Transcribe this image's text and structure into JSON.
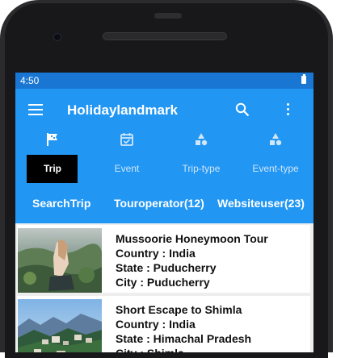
{
  "status_bar": {
    "time": "4:50"
  },
  "app_bar": {
    "title": "Holidaylandmark"
  },
  "tabs": [
    {
      "label": "Trip",
      "icon": "flag-icon",
      "active": true
    },
    {
      "label": "Event",
      "icon": "calendar-check-icon",
      "active": false
    },
    {
      "label": "Trip-type",
      "icon": "shapes-icon",
      "active": false
    },
    {
      "label": "Event-type",
      "icon": "shapes-icon",
      "active": false
    }
  ],
  "subtabs": [
    {
      "label": "SearchTrip"
    },
    {
      "label": "Touroperator(12)"
    },
    {
      "label": "Websiteuser(23)"
    }
  ],
  "trips": [
    {
      "title": "Mussoorie Honeymoon Tour",
      "country": "Country : India",
      "state": "State : Puducherry",
      "city": "City : Puducherry"
    },
    {
      "title": "Short Escape to Shimla",
      "country": "Country : India",
      "state": "State : Himachal Pradesh",
      "city": "City : Shimla"
    }
  ],
  "colors": {
    "primary": "#2196f3",
    "status_bar": "#1976d2",
    "active_tab": "#000000"
  }
}
